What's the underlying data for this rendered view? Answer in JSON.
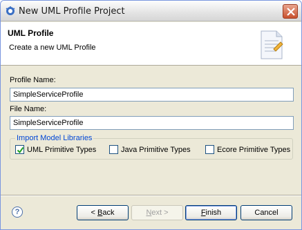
{
  "window": {
    "title": "New UML Profile Project"
  },
  "banner": {
    "title": "UML Profile",
    "message": "Create a new UML Profile"
  },
  "form": {
    "profile_name_label": "Profile Name:",
    "profile_name_value": "SimpleServiceProfile",
    "file_name_label": "File Name:",
    "file_name_value": "SimpleServiceProfile"
  },
  "libraries": {
    "legend": "Import Model Libraries",
    "items": [
      {
        "label": "UML Primitive Types",
        "checked": true
      },
      {
        "label": "Java Primitive Types",
        "checked": false
      },
      {
        "label": "Ecore Primitive Types",
        "checked": false
      }
    ]
  },
  "buttons": {
    "help": "?",
    "back_pre": "< ",
    "back_mnemonic": "B",
    "back_post": "ack",
    "next_mnemonic": "N",
    "next_post": "ext >",
    "finish_mnemonic": "F",
    "finish_post": "inish",
    "cancel": "Cancel"
  }
}
